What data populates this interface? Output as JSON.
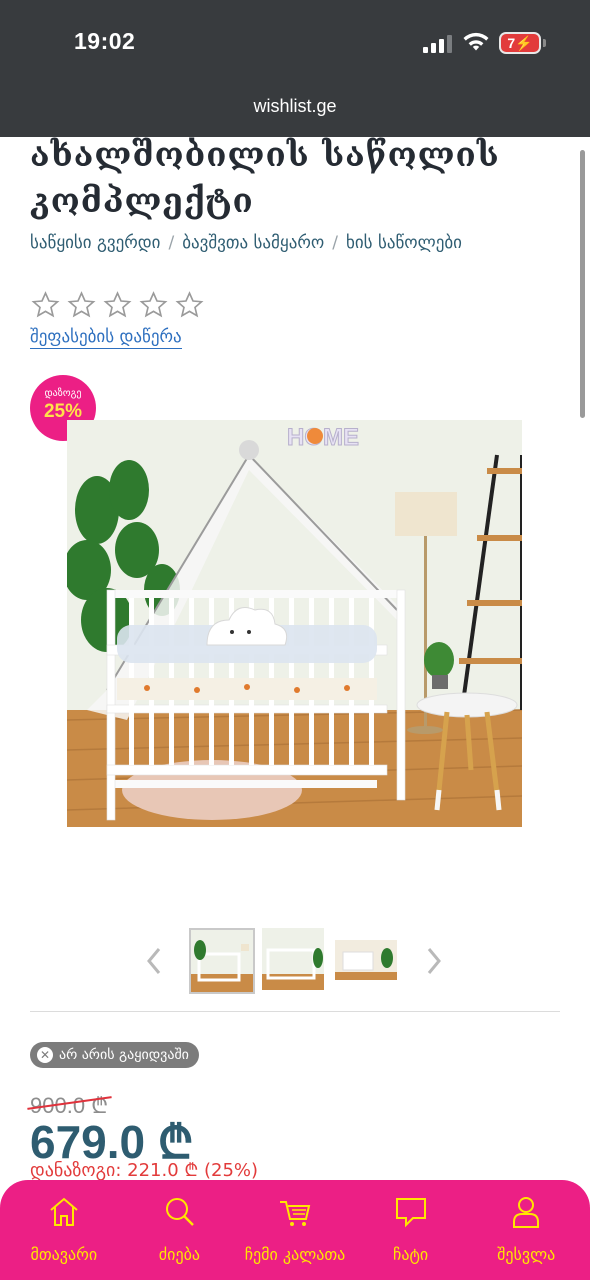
{
  "status_bar": {
    "time": "19:02",
    "battery": "7",
    "signal_icon": "cellular-signal-icon",
    "wifi_icon": "wifi-icon",
    "battery_icon": "battery-charging-icon"
  },
  "browser": {
    "url": "wishlist.ge"
  },
  "product": {
    "title_line1": "ახალშობილის საწოლის",
    "title_line2": "კომპლექტი",
    "breadcrumb": [
      "საწყისი გვერდი",
      "ბავშვთა სამყარო",
      "ხის საწოლები"
    ],
    "breadcrumb_sep": "/",
    "rating_stars": 0,
    "rating_max": 5,
    "write_review": "შეფასების დაწერა",
    "discount_label": "დაზოგე",
    "discount_pct": "25%",
    "stock_status": "არ არის გაყიდვაში",
    "old_price": "900.0 ₾",
    "new_price": "679.0 ₾",
    "savings": "დანაზოგი: 221.0 ₾ (25%)"
  },
  "gallery": {
    "selected_index": 0,
    "thumbnail_count": 3,
    "prev_icon": "chevron-left-icon",
    "next_icon": "chevron-right-icon"
  },
  "bottom_nav": {
    "items": [
      {
        "label": "მთავარი",
        "icon": "home-icon"
      },
      {
        "label": "ძიება",
        "icon": "search-icon"
      },
      {
        "label": "ჩემი კალათა",
        "icon": "cart-icon"
      },
      {
        "label": "ჩატი",
        "icon": "chat-icon"
      },
      {
        "label": "შესვლა",
        "icon": "user-icon"
      }
    ]
  },
  "colors": {
    "accent_pink": "#ec1f85",
    "nav_label_yellow": "#ffe600",
    "price_blue": "#2e5c70",
    "savings_red": "#e23b3b",
    "link_blue": "#2d6fbf"
  }
}
